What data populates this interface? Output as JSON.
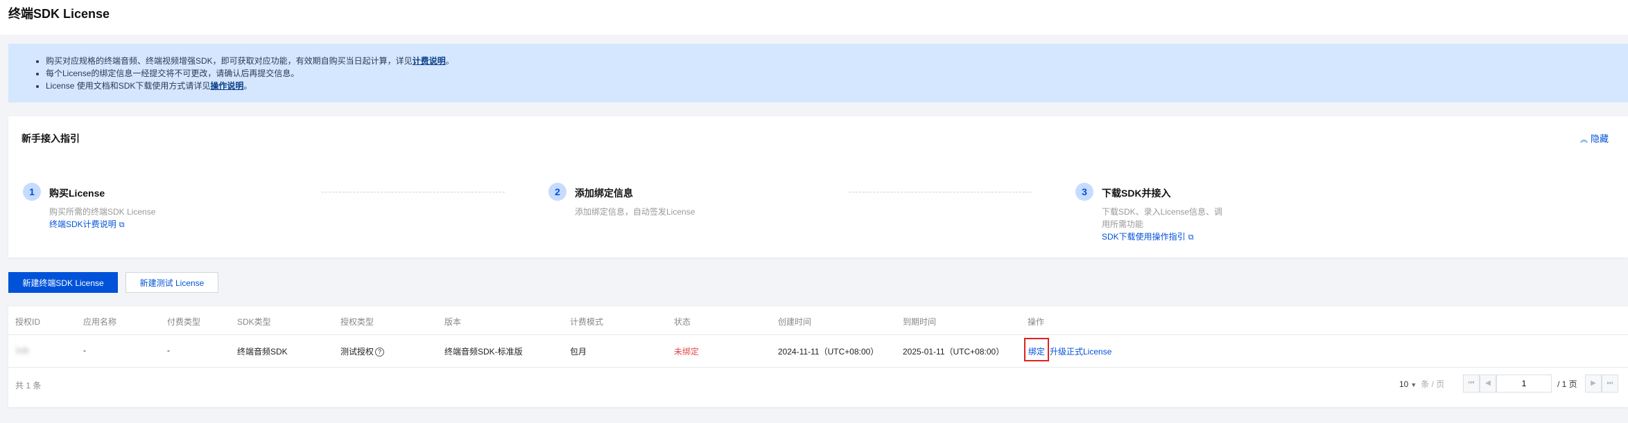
{
  "page": {
    "title": "终端SDK License"
  },
  "notice": {
    "items": [
      {
        "text": "购买对应规格的终端音频、终端视频增强SDK，即可获取对应功能，有效期自购买当日起计算，详见",
        "link": "计费说明",
        "suffix": "。"
      },
      {
        "text": "每个License的绑定信息一经提交将不可更改，请确认后再提交信息。",
        "link": "",
        "suffix": ""
      },
      {
        "text": "License 使用文档和SDK下载使用方式请详见",
        "link": "操作说明",
        "suffix": "。"
      }
    ]
  },
  "guide": {
    "title": "新手接入指引",
    "collapse_label": "隐藏",
    "steps": [
      {
        "num": "1",
        "title": "购买License",
        "desc": "购买所需的终端SDK License",
        "link": "终端SDK计费说明"
      },
      {
        "num": "2",
        "title": "添加绑定信息",
        "desc": "添加绑定信息，自动签发License",
        "link": ""
      },
      {
        "num": "3",
        "title": "下载SDK并接入",
        "desc_line1": "下载SDK、录入License信息、调",
        "desc_line2": "用所需功能",
        "link": "SDK下载使用操作指引"
      }
    ]
  },
  "buttons": {
    "new_sdk_license": "新建终端SDK License",
    "new_test_license": "新建测试 License"
  },
  "table": {
    "columns": [
      "授权ID",
      "应用名称",
      "付费类型",
      "SDK类型",
      "授权类型",
      "版本",
      "计费模式",
      "状态",
      "创建时间",
      "到期时间",
      "操作"
    ],
    "row": {
      "id": "1cb",
      "app_name": "-",
      "pay_type": "-",
      "sdk_type": "终端音频SDK",
      "auth_type": "测试授权",
      "help_mark": "?",
      "version": "终端音频SDK-标准版",
      "billing": "包月",
      "status": "未绑定",
      "created": "2024-11-11（UTC+08:00）",
      "expires": "2025-01-11（UTC+08:00）",
      "action_bind": "绑定",
      "action_upgrade": "升级正式License"
    }
  },
  "pagination": {
    "total_text": "共 1 条",
    "page_size": "10",
    "page_size_unit": "条 / 页",
    "current_page": "1",
    "total_pages": "/ 1 页"
  },
  "colors": {
    "primary": "#0052d9",
    "notice_bg": "#d5e7fe",
    "status_unbound": "#e54545",
    "highlight": "#e02020"
  }
}
